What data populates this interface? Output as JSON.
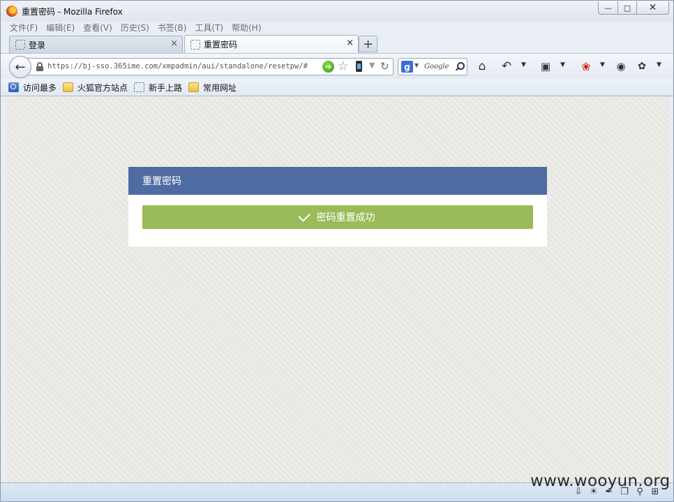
{
  "window": {
    "title": "重置密码 - Mozilla Firefox"
  },
  "menu": [
    "文件(F)",
    "编辑(E)",
    "查看(V)",
    "历史(S)",
    "书签(B)",
    "工具(T)",
    "帮助(H)"
  ],
  "tabs": [
    {
      "label": "登录",
      "active": false
    },
    {
      "label": "重置密码",
      "active": true
    }
  ],
  "urlbar": {
    "url": "https://bj-sso.365ime.com/xmpadmin/aui/standalone/resetpw/#"
  },
  "search": {
    "engine": "Google"
  },
  "bookmarks": [
    "访问最多",
    "火狐官方站点",
    "新手上路",
    "常用网址"
  ],
  "page": {
    "panel_title": "重置密码",
    "success_message": "密码重置成功"
  },
  "colors": {
    "panel_header": "#4f6ca2",
    "success": "#9abb5a"
  },
  "watermark": "www.wooyun.org"
}
